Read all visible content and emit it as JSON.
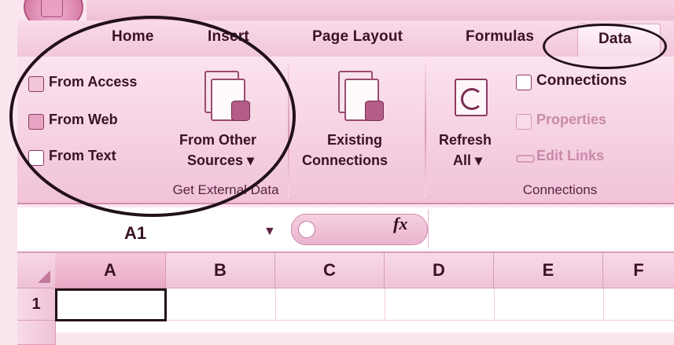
{
  "tabs": [
    {
      "label": "Home"
    },
    {
      "label": "Insert"
    },
    {
      "label": "Page Layout"
    },
    {
      "label": "Formulas"
    },
    {
      "label": "Data"
    }
  ],
  "get_external_data": {
    "from_access": "From Access",
    "from_web": "From Web",
    "from_text": "From Text",
    "from_other_line1": "From Other",
    "from_other_line2": "Sources ▾",
    "existing_line1": "Existing",
    "existing_line2": "Connections",
    "group_label": "Get External Data"
  },
  "connections": {
    "refresh_line1": "Refresh",
    "refresh_line2": "All ▾",
    "connections": "Connections",
    "properties": "Properties",
    "edit_links": "Edit Links",
    "group_label": "Connections"
  },
  "name_box": {
    "value": "A1"
  },
  "formula_bar": {
    "fx": "fx",
    "value": ""
  },
  "grid": {
    "columns": [
      "A",
      "B",
      "C",
      "D",
      "E",
      "F"
    ],
    "rows": [
      "1"
    ]
  },
  "colors": {
    "tint": "#f2c6da",
    "annotation": "#22101a"
  }
}
